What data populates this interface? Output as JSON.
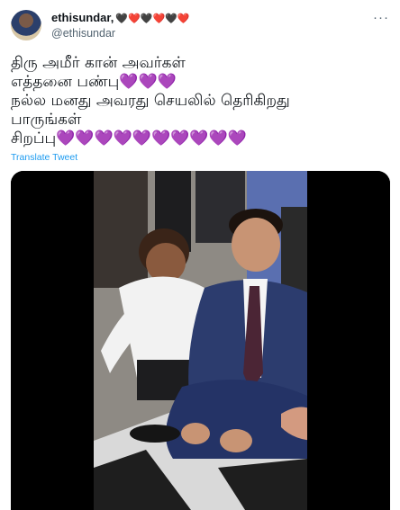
{
  "author": {
    "name": "ethisundar,",
    "hearts": "🖤❤️🖤❤️🖤❤️",
    "handle": "@ethisundar"
  },
  "tweet": {
    "lines": [
      "திரு அமீர் கான் அவர்கள்",
      "எத்தனை பண்பு💜💜💜",
      "நல்ல மனது அவரது செயலில் தெரிகிறது",
      "பாருங்கள்",
      "சிறப்பு💜💜💜💜💜💜💜💜💜💜"
    ],
    "translate_label": "Translate Tweet"
  },
  "colors": {
    "link": "#1d9bf0",
    "secondary_text": "#536471",
    "heart_purple": "#a98be8",
    "suit_navy": "#2c3c6e",
    "floor_light": "#d9d9d9"
  },
  "icons": {
    "more": "more-dots-icon"
  }
}
